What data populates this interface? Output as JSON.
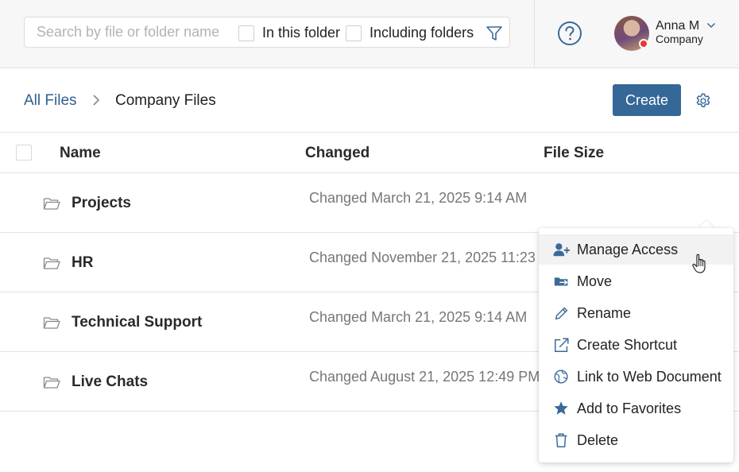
{
  "header": {
    "search": {
      "placeholder": "Search by file or folder name",
      "value": ""
    },
    "options": [
      {
        "label": "In this folder",
        "checked": false
      },
      {
        "label": "Including folders",
        "checked": false
      }
    ],
    "user": {
      "name": "Anna M",
      "company": "Company",
      "status_color": "#e53935"
    }
  },
  "breadcrumb": {
    "root": "All Files",
    "current": "Company Files"
  },
  "toolbar": {
    "create_label": "Create"
  },
  "table": {
    "columns": [
      "Name",
      "Changed",
      "File Size"
    ],
    "rows": [
      {
        "name": "Projects",
        "changed": "Changed March 21, 2025 9:14 AM",
        "size": ""
      },
      {
        "name": "HR",
        "changed": "Changed November 21, 2025 11:23 AM",
        "size": ""
      },
      {
        "name": "Technical Support",
        "changed": "Changed March 21, 2025 9:14 AM",
        "size": ""
      },
      {
        "name": "Live Chats",
        "changed": "Changed August 21, 2025 12:49 PM",
        "size": ""
      }
    ]
  },
  "context_menu": {
    "items": [
      {
        "label": "Manage Access",
        "icon": "user-plus-icon",
        "hovered": true
      },
      {
        "label": "Move",
        "icon": "move-folder-icon"
      },
      {
        "label": "Rename",
        "icon": "pencil-icon"
      },
      {
        "label": "Create Shortcut",
        "icon": "external-link-icon"
      },
      {
        "label": "Link to Web Document",
        "icon": "web-document-icon"
      },
      {
        "label": "Add to Favorites",
        "icon": "star-icon"
      },
      {
        "label": "Delete",
        "icon": "trash-icon"
      }
    ]
  },
  "colors": {
    "accent": "#356797",
    "link": "#2f5f8f",
    "icon": "#3a6a99"
  }
}
